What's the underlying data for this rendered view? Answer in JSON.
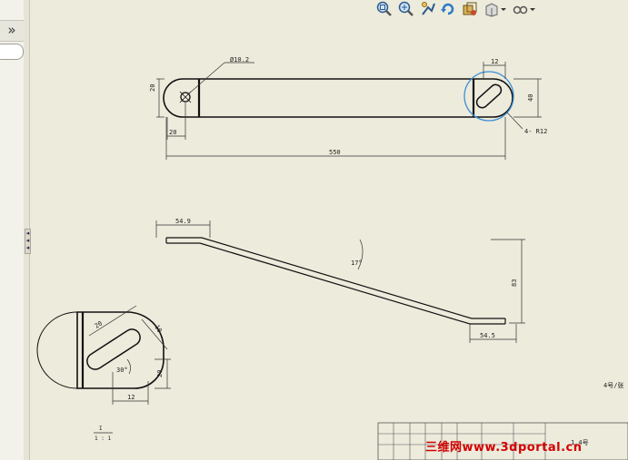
{
  "sidebar": {
    "toggle_glyph": "»"
  },
  "toolbar": {
    "items": [
      {
        "name": "zoom-to-fit-icon"
      },
      {
        "name": "zoom-to-area-icon"
      },
      {
        "name": "pan-icon"
      },
      {
        "name": "rotate-view-icon"
      },
      {
        "name": "display-style-icon"
      },
      {
        "name": "view-orientation-icon",
        "dropdown": true
      },
      {
        "name": "hide-show-items-icon",
        "dropdown": true
      }
    ]
  },
  "drawing": {
    "top_view": {
      "dia_label": "Ø10.2",
      "left_height": "20",
      "left_offset": "20",
      "slot_width": "12",
      "right_height": "40",
      "radius_note": "4- R12",
      "overall_length": "550"
    },
    "side_view": {
      "left_flat": "54.9",
      "angle": "17°",
      "height": "83",
      "right_flat": "54.5"
    },
    "detail_view": {
      "slot_length": "20",
      "slot_width": "10",
      "angle": "30°",
      "height": "20",
      "width": "12"
    },
    "scale_label_top": "I",
    "scale_label_bottom": "1 : 1",
    "title_text": "1.4号",
    "right_note": "4号/张"
  },
  "watermark": "三维网www.3dportal.cn",
  "colors": {
    "background": "#ecebdc",
    "line": "#111111",
    "highlight": "#3b8ed8",
    "watermark": "#d40000"
  }
}
